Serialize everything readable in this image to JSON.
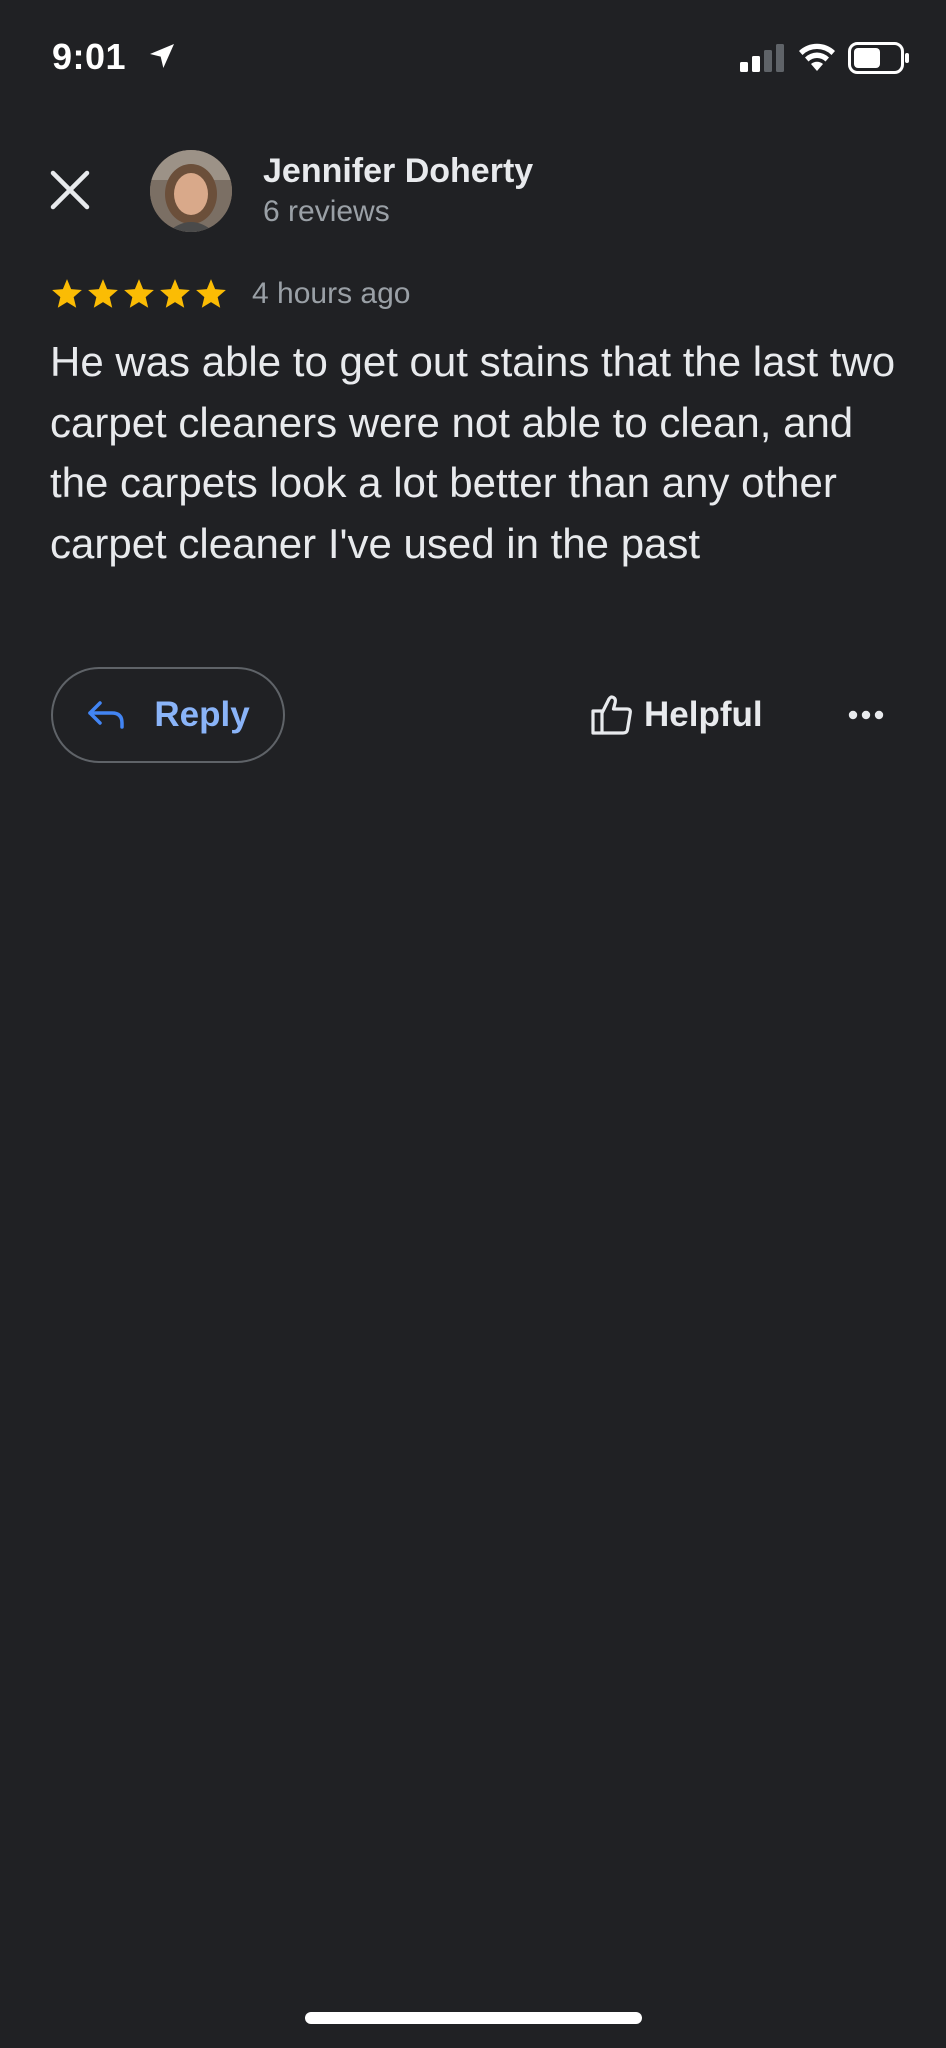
{
  "status_bar": {
    "time": "9:01",
    "icons": [
      "location-arrow-icon",
      "cellular-signal-icon",
      "wifi-icon",
      "battery-icon"
    ]
  },
  "header": {
    "close_icon": "close-icon",
    "author_name": "Jennifer Doherty",
    "review_count": "6 reviews"
  },
  "review": {
    "rating": 5,
    "max_rating": 5,
    "star_color": "#fbbc04",
    "time_ago": "4 hours ago",
    "text": "He was able to get out stains that the last two carpet cleaners were not able to clean, and the carpets look a lot better than any other carpet cleaner I've used in the past"
  },
  "actions": {
    "reply_label": "Reply",
    "reply_icon": "reply-arrow-icon",
    "helpful_label": "Helpful",
    "helpful_icon": "thumbs-up-icon",
    "more_icon": "more-horizontal-icon"
  },
  "colors": {
    "background": "#202124",
    "text_primary": "#e8eaed",
    "text_secondary": "#9aa0a6",
    "accent": "#8ab4f8",
    "reply_icon_color": "#4285f4"
  }
}
